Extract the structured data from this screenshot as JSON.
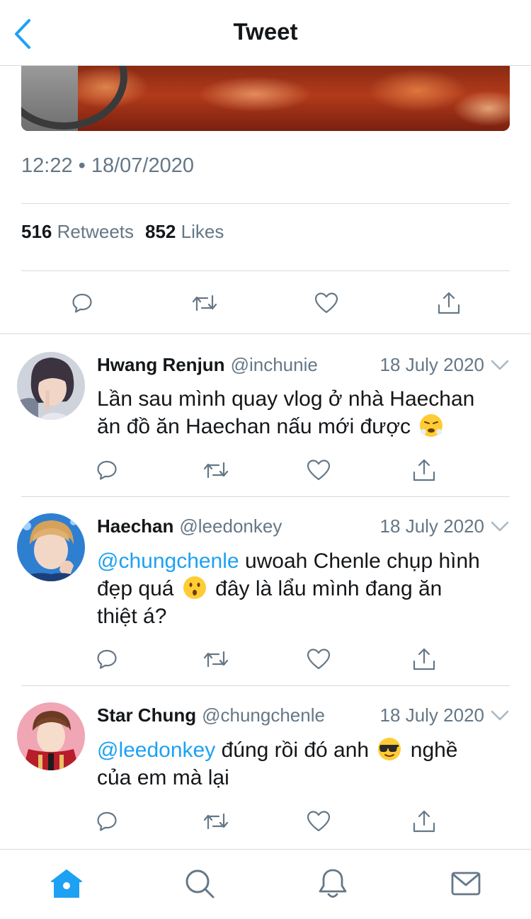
{
  "nav": {
    "title": "Tweet",
    "back_icon": "chevron-left-icon"
  },
  "tweet": {
    "timestamp": "12:22 • 18/07/2020",
    "retweets_count": "516",
    "retweets_label": "Retweets",
    "likes_count": "852",
    "likes_label": "Likes"
  },
  "replies": [
    {
      "name": "Hwang Renjun",
      "handle": "@inchunie",
      "date": "18 July 2020",
      "text_line1": "Lần sau mình quay vlog ở nhà Haechan",
      "text_line2": "ăn đồ ăn Haechan nấu mới được",
      "emoji": "huffing-face-emoji"
    },
    {
      "name": "Haechan",
      "handle": "@leedonkey",
      "date": "18 July 2020",
      "mention": "@chungchenle",
      "text_a": " uwoah Chenle chụp hình",
      "text_b": "đẹp quá",
      "text_c": " đây là lẩu mình đang ăn",
      "text_d": "thiệt á?",
      "emoji": "hushed-face-emoji"
    },
    {
      "name": "Star Chung",
      "handle": "@chungchenle",
      "date": "18 July 2020",
      "mention": "@leedonkey",
      "text_a": " đúng rồi đó anh",
      "text_b": " nghề",
      "text_c": "của em mà lại",
      "emoji": "sunglasses-face-emoji"
    }
  ],
  "colors": {
    "accent": "#1da1f2",
    "secondary_text": "#657786",
    "primary_text": "#14171a",
    "divider": "#d6dbe0"
  },
  "tabs": [
    "home-icon",
    "search-icon",
    "bell-icon",
    "mail-icon"
  ]
}
